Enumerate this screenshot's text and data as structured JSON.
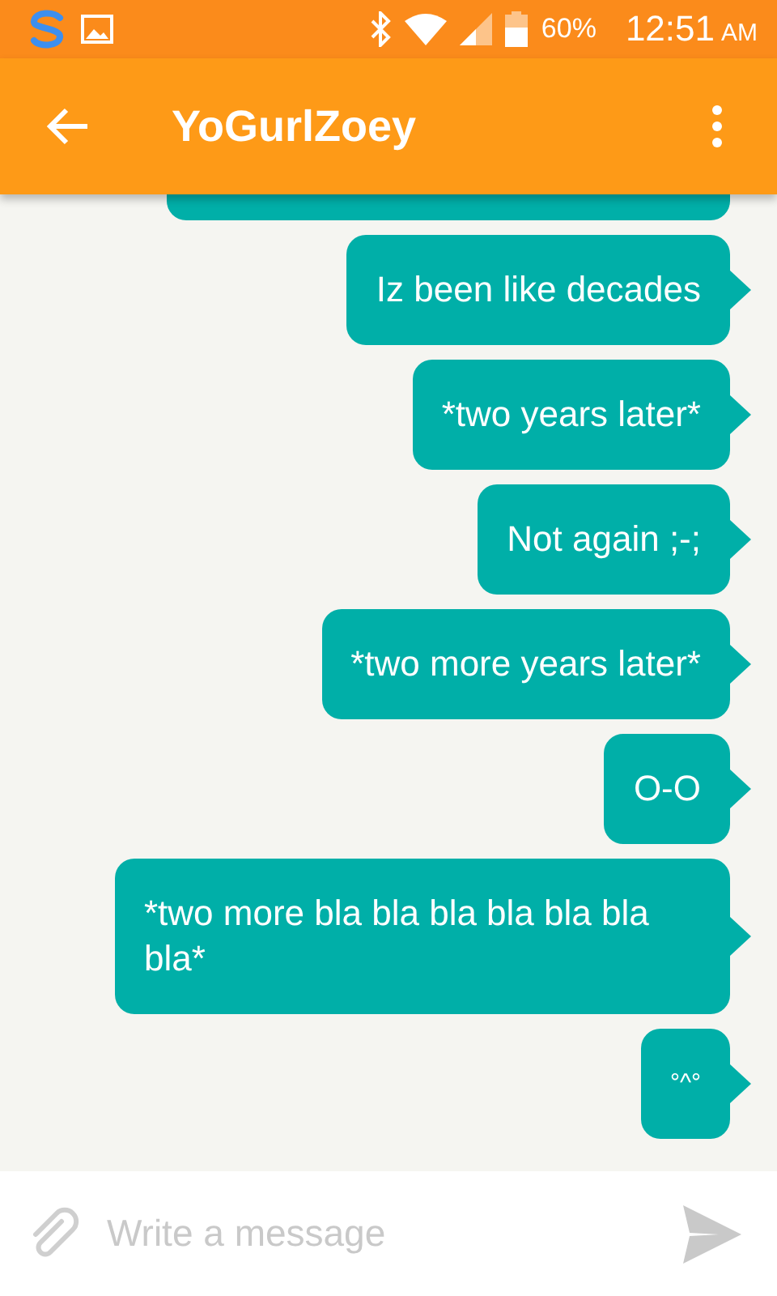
{
  "status_bar": {
    "battery": "60%",
    "time": "12:51",
    "meridiem": "AM"
  },
  "app_bar": {
    "title": "YoGurlZoey"
  },
  "messages": [
    {
      "text": "Iz been like decades"
    },
    {
      "text": "*two years later*"
    },
    {
      "text": "Not again ;-;"
    },
    {
      "text": "*two more years later*"
    },
    {
      "text": "O-O"
    },
    {
      "text": "*two more bla bla bla bla bla bla bla*"
    },
    {
      "text": "°^°",
      "kind": "small"
    }
  ],
  "composer": {
    "placeholder": "Write a message"
  }
}
